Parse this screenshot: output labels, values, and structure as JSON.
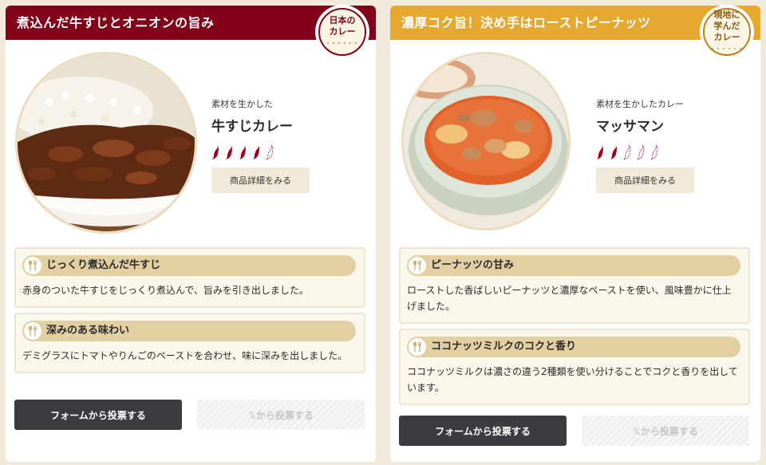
{
  "cards": [
    {
      "header": "煮込んだ牛すじとオニオンの旨み",
      "badge": [
        "日本の",
        "カレー"
      ],
      "photo": "beef-tendon-curry-photo",
      "subtitle": "素材を生かした",
      "name": "牛すじカレー",
      "spice_level": 4,
      "spice_max": 5,
      "detail_button": "商品詳細をみる",
      "features": [
        {
          "title": "じっくり煮込んだ牛すじ",
          "text": "赤身のついた牛すじをじっくり煮込んで、旨みを引き出しました。"
        },
        {
          "title": "深みのある味わい",
          "text": "デミグラスにトマトやりんごのペーストを合わせ、味に深みを出しました。"
        }
      ],
      "vote_form": "フォームから投票する",
      "vote_x": "𝕏から投票する"
    },
    {
      "header": "濃厚コク旨！決め手はローストピーナッツ",
      "badge": [
        "現地に",
        "学んだ",
        "カレー"
      ],
      "photo": "massaman-curry-photo",
      "subtitle": "素材を生かしたカレー",
      "name": "マッサマン",
      "spice_level": 2,
      "spice_max": 5,
      "detail_button": "商品詳細をみる",
      "features": [
        {
          "title": "ピーナッツの甘み",
          "text": "ローストした香ばしいピーナッツと濃厚なペーストを使い、風味豊かに仕上げました。"
        },
        {
          "title": "ココナッツミルクのコクと香り",
          "text": "ココナッツミルクは濃さの違う2種類を使い分けることでコクと香りを出しています。"
        }
      ],
      "vote_form": "フォームから投票する",
      "vote_x": "𝕏から投票する"
    }
  ],
  "colors": {
    "left_header": "#82021a",
    "right_header": "#e5a830",
    "chili": "#a0001c"
  }
}
